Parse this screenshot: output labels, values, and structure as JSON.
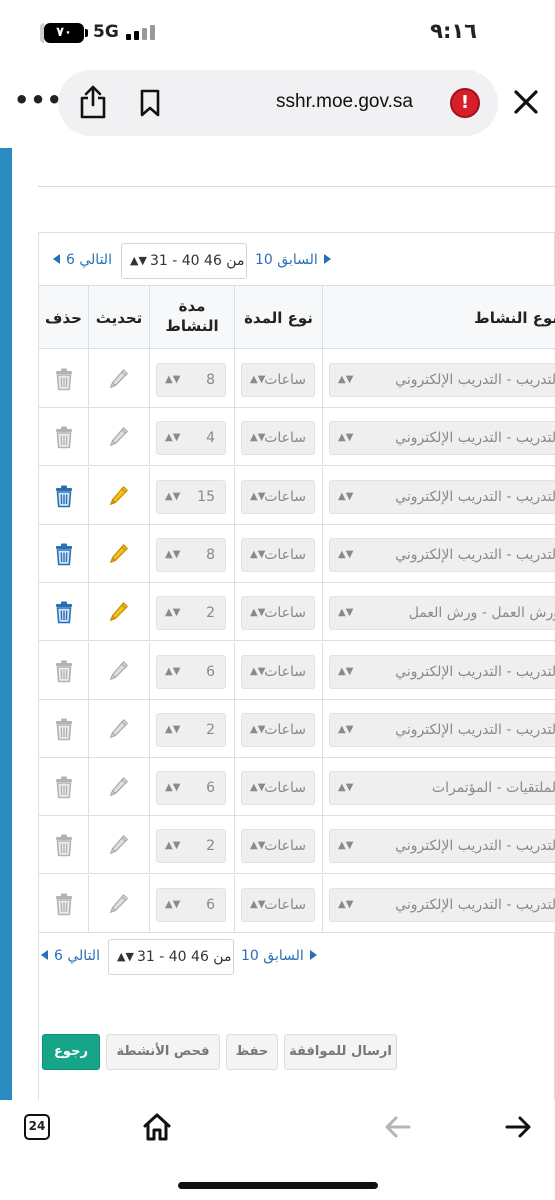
{
  "status_bar": {
    "time": "٩:١٦",
    "battery": "٧٠",
    "network": "5G"
  },
  "browser": {
    "url": "sshr.moe.gov.sa",
    "alert_symbol": "!",
    "more_symbol": "•••"
  },
  "pager_top": {
    "next_label": "التالي 6",
    "range_label": "31 - 40 من 46",
    "prev_label": "السابق 10"
  },
  "pager_bottom": {
    "next_label": "التالي 6",
    "range_label": "31 - 40 من 46",
    "prev_label": "السابق 10"
  },
  "table": {
    "headers": {
      "delete": "حذف",
      "update": "تحديث",
      "duration_line1": "مدة",
      "duration_line2": "النشاط",
      "duration_type": "نوع المدة",
      "activity_type": "نوع النشاط"
    },
    "rows": [
      {
        "activity": "التدريب - التدريب الإلكتروني",
        "duration_type": "ساعات",
        "duration": "8",
        "enabled": false
      },
      {
        "activity": "التدريب - التدريب الإلكتروني",
        "duration_type": "ساعات",
        "duration": "4",
        "enabled": false
      },
      {
        "activity": "التدريب - التدريب الإلكتروني",
        "duration_type": "ساعات",
        "duration": "15",
        "enabled": true
      },
      {
        "activity": "التدريب - التدريب الإلكتروني",
        "duration_type": "ساعات",
        "duration": "8",
        "enabled": true
      },
      {
        "activity": "ورش العمل - ورش العمل",
        "duration_type": "ساعات",
        "duration": "2",
        "enabled": true
      },
      {
        "activity": "التدريب - التدريب الإلكتروني",
        "duration_type": "ساعات",
        "duration": "6",
        "enabled": false
      },
      {
        "activity": "التدريب - التدريب الإلكتروني",
        "duration_type": "ساعات",
        "duration": "2",
        "enabled": false
      },
      {
        "activity": "الملتقيات - المؤتمرات",
        "duration_type": "ساعات",
        "duration": "6",
        "enabled": false
      },
      {
        "activity": "التدريب - التدريب الإلكتروني",
        "duration_type": "ساعات",
        "duration": "2",
        "enabled": false
      },
      {
        "activity": "التدريب - التدريب الإلكتروني",
        "duration_type": "ساعات",
        "duration": "6",
        "enabled": false
      }
    ]
  },
  "actions": {
    "back": "رجوع",
    "check": "فحص الأنشطة",
    "save": "حفظ",
    "send": "ارسال للموافقة"
  },
  "toolbar": {
    "tabs_count": "24"
  },
  "colors": {
    "accent_rail": "#2b8bbf",
    "back_button": "#17a589",
    "link": "#2a6fb6",
    "alert": "#d71f2a"
  }
}
